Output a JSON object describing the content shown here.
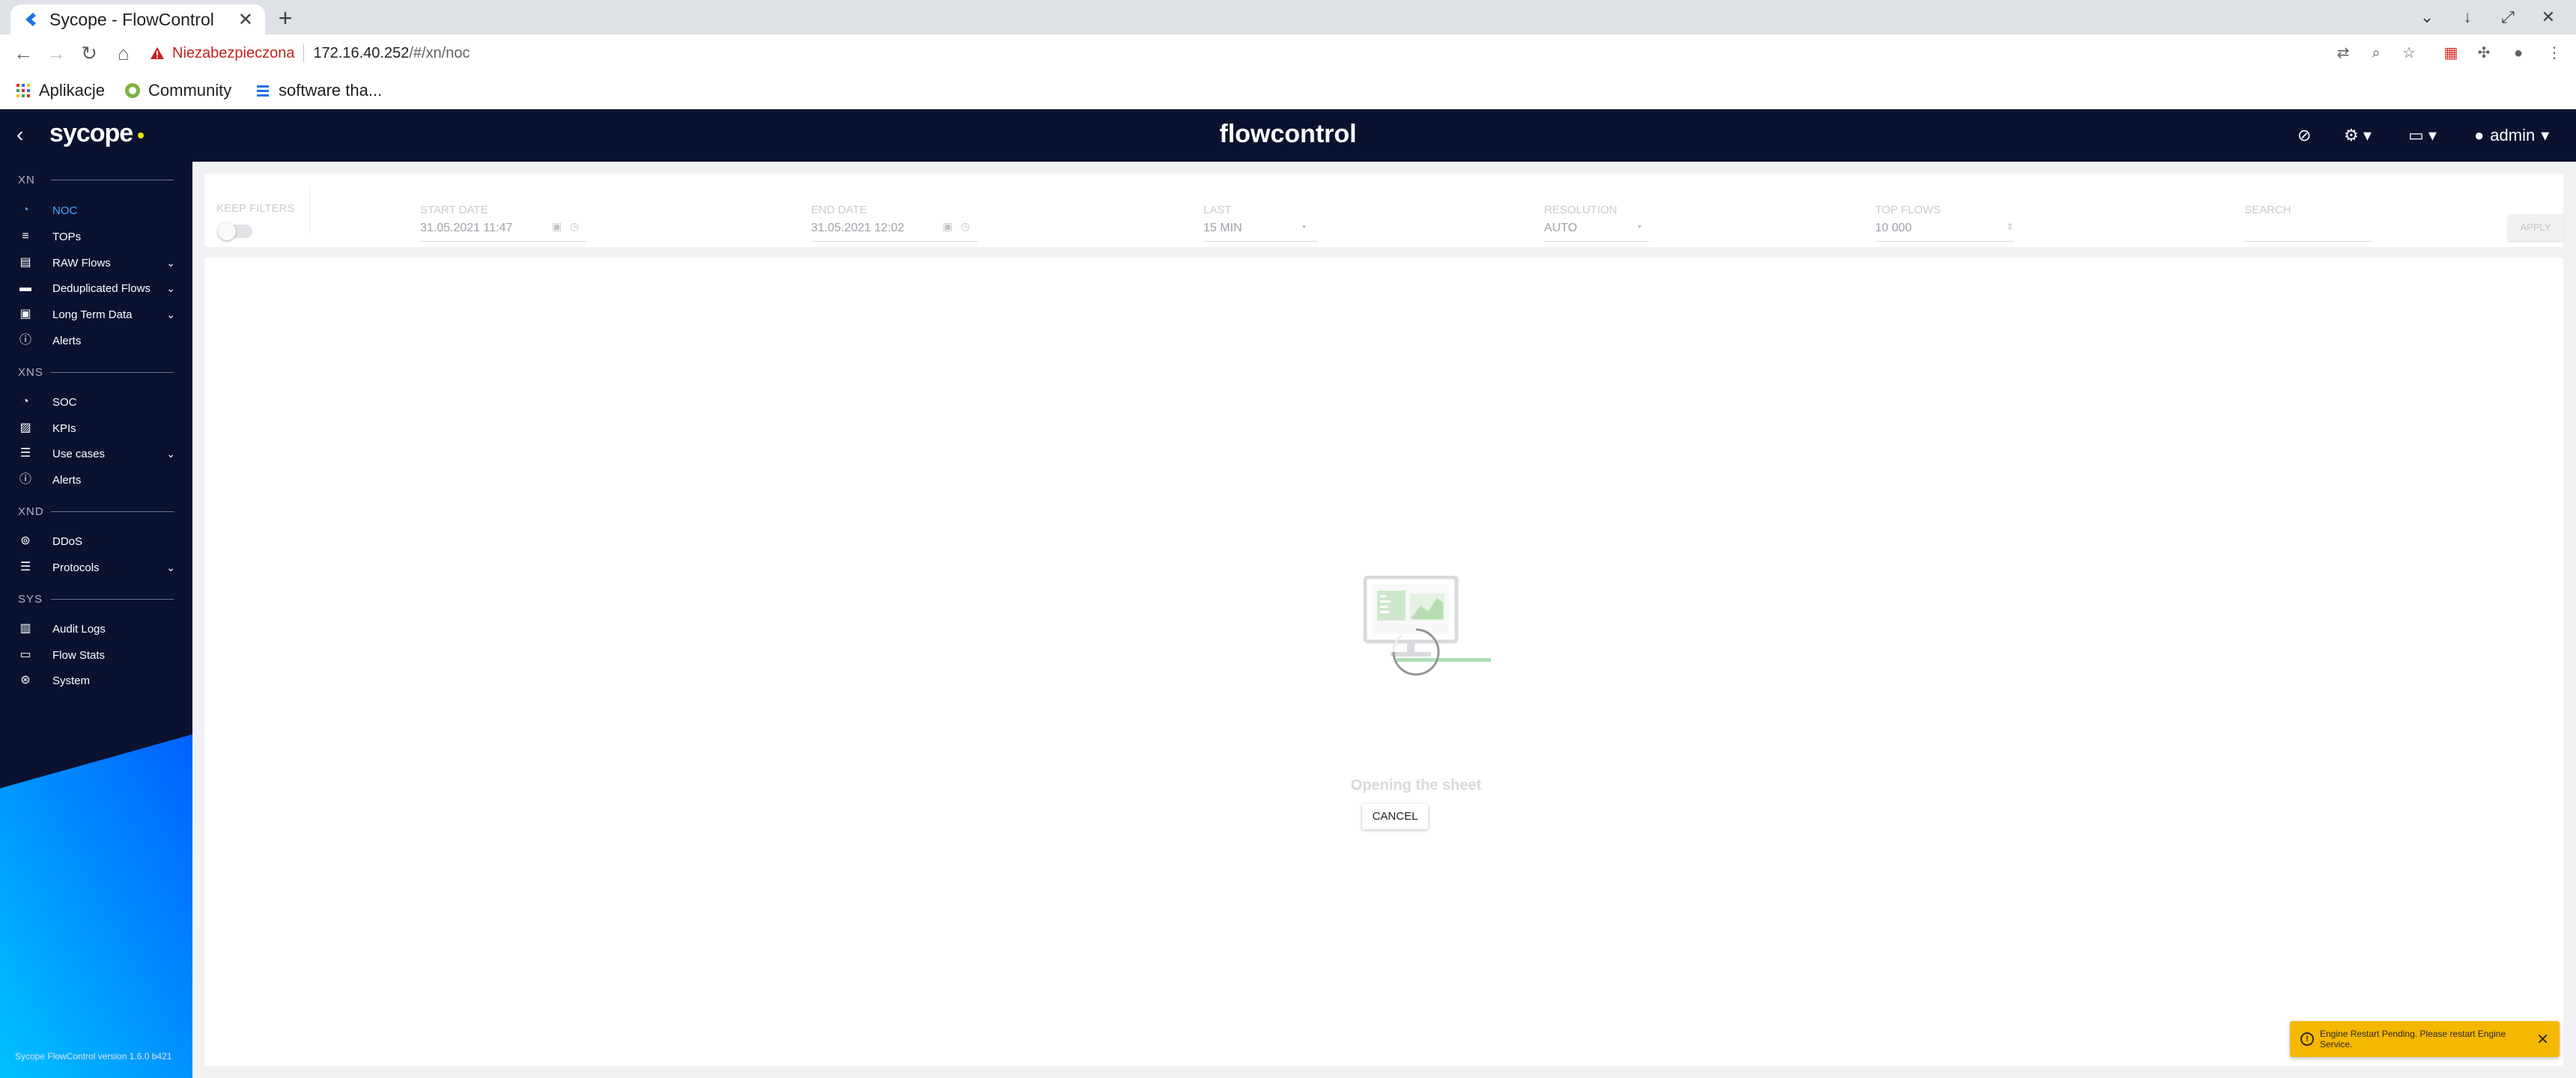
{
  "browser": {
    "tab_title": "Sycope - FlowControl",
    "security_label": "Niezabezpieczona",
    "url_host": "172.16.40.252",
    "url_path": "/#/xn/noc",
    "bookmarks": [
      "Aplikacje",
      "Community",
      "software tha..."
    ]
  },
  "app": {
    "logo": "sycope",
    "product": "flowcontrol",
    "user": "admin"
  },
  "sidebar": {
    "sections": [
      {
        "label": "XN",
        "items": [
          {
            "label": "NOC",
            "icon": "dashboard-icon",
            "active": true
          },
          {
            "label": "TOPs",
            "icon": "list-icon"
          },
          {
            "label": "RAW Flows",
            "icon": "table-icon",
            "expand": true
          },
          {
            "label": "Deduplicated Flows",
            "icon": "table-icon",
            "expand": true
          },
          {
            "label": "Long Term Data",
            "icon": "calendar-icon",
            "expand": true
          },
          {
            "label": "Alerts",
            "icon": "alert-icon"
          }
        ]
      },
      {
        "label": "XNS",
        "items": [
          {
            "label": "SOC",
            "icon": "dashboard-icon"
          },
          {
            "label": "KPIs",
            "icon": "kpi-icon"
          },
          {
            "label": "Use cases",
            "icon": "list-icon",
            "expand": true
          },
          {
            "label": "Alerts",
            "icon": "alert-icon"
          }
        ]
      },
      {
        "label": "XND",
        "items": [
          {
            "label": "DDoS",
            "icon": "ddos-icon"
          },
          {
            "label": "Protocols",
            "icon": "list-icon",
            "expand": true
          }
        ]
      },
      {
        "label": "SYS",
        "items": [
          {
            "label": "Audit Logs",
            "icon": "log-icon"
          },
          {
            "label": "Flow Stats",
            "icon": "monitor-icon"
          },
          {
            "label": "System",
            "icon": "system-icon"
          }
        ]
      }
    ],
    "version": "Sycope FlowControl version 1.6.0 b421"
  },
  "filters": {
    "keep_filters": "KEEP FILTERS",
    "start_date_label": "START DATE",
    "start_date": "31.05.2021 11:47",
    "end_date_label": "END DATE",
    "end_date": "31.05.2021 12:02",
    "last_label": "LAST",
    "last": "15 MIN",
    "resolution_label": "RESOLUTION",
    "resolution": "AUTO",
    "top_flows_label": "TOP FLOWS",
    "top_flows": "10 000",
    "search_label": "SEARCH",
    "search_value": "",
    "apply": "APPLY"
  },
  "loader": {
    "text": "Opening the sheet",
    "cancel": "CANCEL"
  },
  "toast": {
    "text": "Engine Restart Pending. Please restart Engine Service."
  },
  "colors": {
    "header_bg": "#0b1230",
    "active_nav": "#4aa3ff",
    "toast_bg": "#f6b700",
    "swoosh": "#00aaff"
  }
}
